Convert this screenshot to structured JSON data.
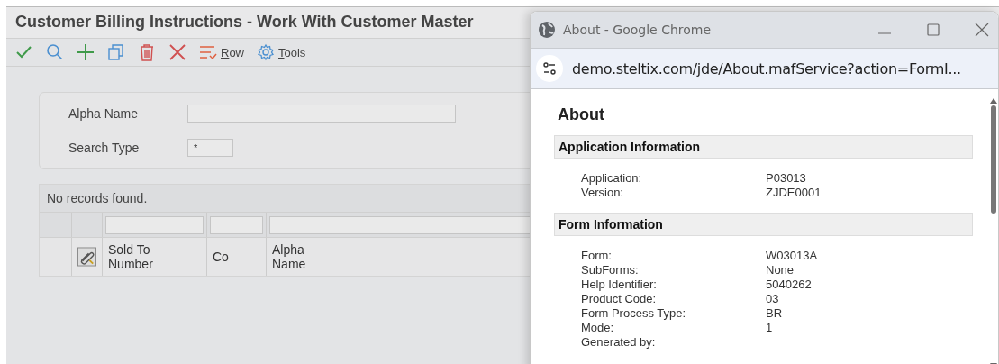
{
  "window": {
    "title": "Customer Billing Instructions - Work With Customer Master"
  },
  "toolbar": [
    {
      "kind": "ok"
    },
    {
      "kind": "find"
    },
    {
      "kind": "add"
    },
    {
      "kind": "copy"
    },
    {
      "kind": "delete"
    },
    {
      "kind": "close"
    },
    {
      "kind": "row",
      "label": "Row"
    },
    {
      "kind": "tools",
      "label": "Tools"
    }
  ],
  "filters": [
    {
      "label": "Alpha Name",
      "kind": "wide"
    },
    {
      "label": "Search Type",
      "value": "*",
      "kind": "short"
    }
  ],
  "grid": {
    "message": "No records found.",
    "columns": [
      {
        "label": "Sold To\nNumber"
      },
      {
        "label": "Co"
      },
      {
        "label": "Alpha\nName"
      }
    ]
  },
  "popup": {
    "title": "About - Google Chrome",
    "url": "demo.steltix.com/jde/About.mafService?action=FormI...",
    "heading": "About",
    "sections": [
      {
        "title": "Application Information",
        "rows": [
          {
            "label": "Application:",
            "value": "P03013"
          },
          {
            "label": "Version:",
            "value": "ZJDE0001"
          }
        ]
      },
      {
        "title": "Form Information",
        "rows": [
          {
            "label": "Form:",
            "value": "W03013A"
          },
          {
            "label": "SubForms:",
            "value": "None"
          },
          {
            "label": "Help Identifier:",
            "value": "5040262"
          },
          {
            "label": "Product Code:",
            "value": "03"
          },
          {
            "label": "Form Process Type:",
            "value": "BR"
          },
          {
            "label": "Mode:",
            "value": "1"
          },
          {
            "label": "Generated by:"
          }
        ]
      }
    ]
  }
}
